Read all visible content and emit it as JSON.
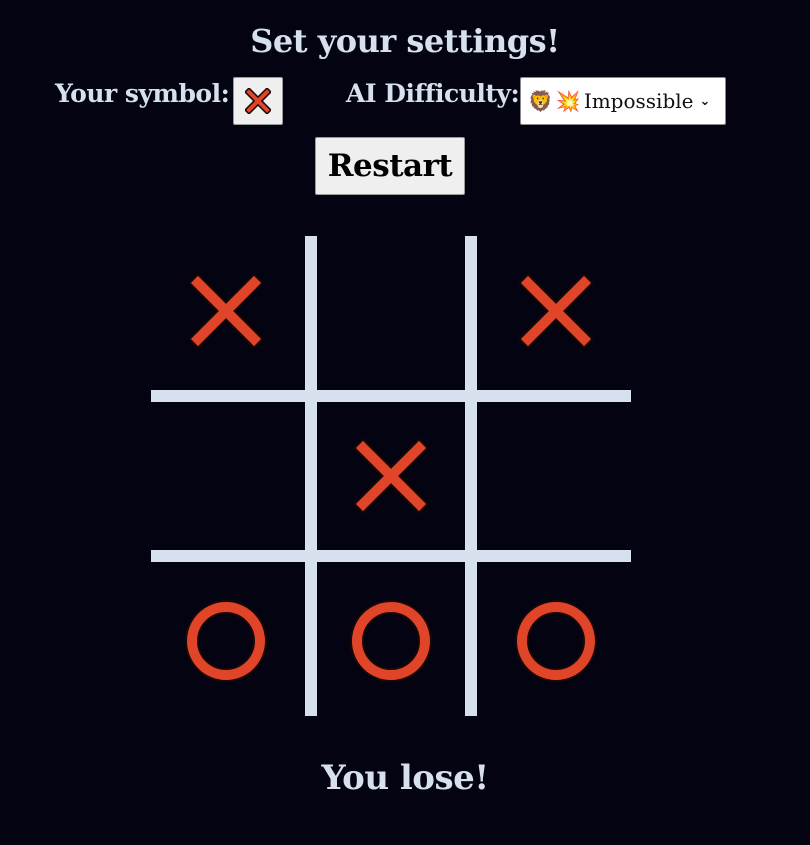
{
  "header": {
    "title": "Set your settings!"
  },
  "settings": {
    "symbol_label": "Your symbol:",
    "symbol_value": "X",
    "difficulty_label": "AI Difficulty:",
    "difficulty_selected": "Impossible",
    "difficulty_emojis": [
      "🦁",
      "💥"
    ]
  },
  "controls": {
    "restart_label": "Restart"
  },
  "board": {
    "cells": [
      "X",
      "",
      "X",
      "",
      "X",
      "",
      "O",
      "O",
      "O"
    ]
  },
  "status": {
    "message": "You lose!"
  },
  "colors": {
    "background": "#030312",
    "text": "#d7e0ee",
    "mark": "#e0452a",
    "grid": "#d7e0ee"
  }
}
